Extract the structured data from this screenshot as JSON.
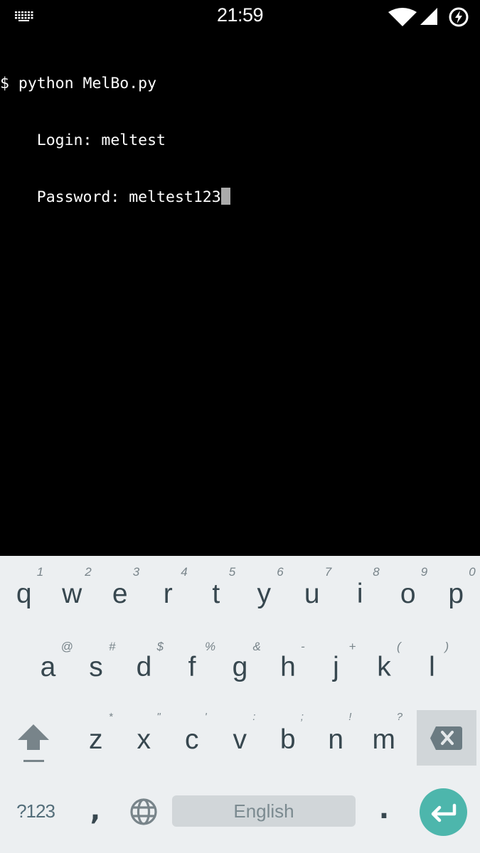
{
  "status_bar": {
    "time": "21:59",
    "icons": [
      "keyboard-icon",
      "wifi-icon",
      "cell-signal-icon",
      "battery-charging-icon"
    ]
  },
  "terminal": {
    "lines": [
      "$ python MelBo.py",
      "    Login: meltest",
      "    Password: meltest123"
    ],
    "cursor_visible": true
  },
  "keyboard": {
    "colors": {
      "background": "#eceff1",
      "key_text": "#37474f",
      "hint_text": "#78848a",
      "functional_key_bg": "#d1d6d9",
      "enter_accent": "#4db6ac"
    },
    "row1": [
      {
        "key": "q",
        "hint": "1"
      },
      {
        "key": "w",
        "hint": "2"
      },
      {
        "key": "e",
        "hint": "3"
      },
      {
        "key": "r",
        "hint": "4"
      },
      {
        "key": "t",
        "hint": "5"
      },
      {
        "key": "y",
        "hint": "6"
      },
      {
        "key": "u",
        "hint": "7"
      },
      {
        "key": "i",
        "hint": "8"
      },
      {
        "key": "o",
        "hint": "9"
      },
      {
        "key": "p",
        "hint": "0"
      }
    ],
    "row2": [
      {
        "key": "a",
        "hint": "@"
      },
      {
        "key": "s",
        "hint": "#"
      },
      {
        "key": "d",
        "hint": "$"
      },
      {
        "key": "f",
        "hint": "%"
      },
      {
        "key": "g",
        "hint": "&"
      },
      {
        "key": "h",
        "hint": "-"
      },
      {
        "key": "j",
        "hint": "+"
      },
      {
        "key": "k",
        "hint": "("
      },
      {
        "key": "l",
        "hint": ")"
      }
    ],
    "row3": [
      {
        "key": "z",
        "hint": "*"
      },
      {
        "key": "x",
        "hint": "\""
      },
      {
        "key": "c",
        "hint": "'"
      },
      {
        "key": "v",
        "hint": ":"
      },
      {
        "key": "b",
        "hint": ";"
      },
      {
        "key": "n",
        "hint": "!"
      },
      {
        "key": "m",
        "hint": "?"
      }
    ],
    "bottom": {
      "symbols_label": "?123",
      "comma_label": ",",
      "space_label": "English",
      "period_label": "."
    }
  }
}
